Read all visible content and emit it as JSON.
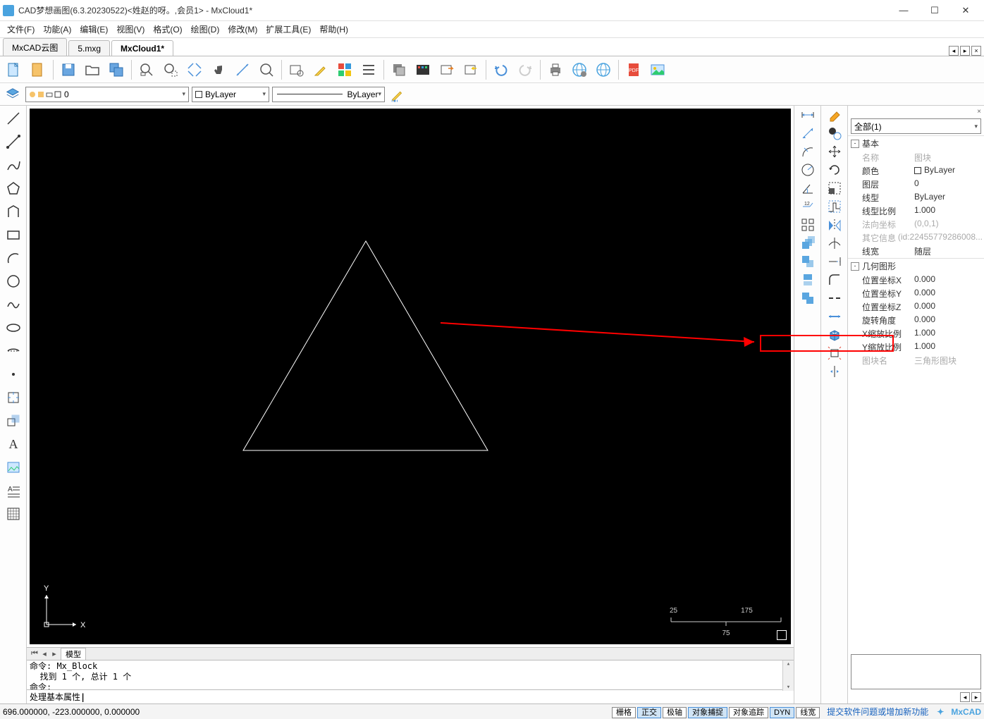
{
  "window": {
    "title": "CAD梦想画图(6.3.20230522)<姓赵的呀。,会员1> - MxCloud1*"
  },
  "menu": [
    "文件(F)",
    "功能(A)",
    "编辑(E)",
    "视图(V)",
    "格式(O)",
    "绘图(D)",
    "修改(M)",
    "扩展工具(E)",
    "帮助(H)"
  ],
  "doctabs": [
    {
      "label": "MxCAD云图",
      "active": false
    },
    {
      "label": "5.mxg",
      "active": false
    },
    {
      "label": "MxCloud1*",
      "active": true
    }
  ],
  "layerbar": {
    "layer_value": "0",
    "color_value": "ByLayer",
    "linetype_value": "ByLayer"
  },
  "properties": {
    "selector": "全部(1)",
    "groups": [
      {
        "title": "基本",
        "rows": [
          {
            "k": "名称",
            "v": "图块",
            "muted": true
          },
          {
            "k": "颜色",
            "v": "ByLayer",
            "swatch": true
          },
          {
            "k": "图层",
            "v": "0"
          },
          {
            "k": "线型",
            "v": "ByLayer"
          },
          {
            "k": "线型比例",
            "v": "1.000"
          },
          {
            "k": "法向坐标",
            "v": "(0,0,1)",
            "muted": true
          },
          {
            "k": "其它信息",
            "v": "(id:22455779286008...",
            "muted": true
          },
          {
            "k": "线宽",
            "v": "随层"
          }
        ]
      },
      {
        "title": "几何图形",
        "rows": [
          {
            "k": "位置坐标X",
            "v": "0.000"
          },
          {
            "k": "位置坐标Y",
            "v": "0.000"
          },
          {
            "k": "位置坐标Z",
            "v": "0.000"
          },
          {
            "k": "旋转角度",
            "v": "0.000"
          },
          {
            "k": "X缩放比例",
            "v": "1.000"
          },
          {
            "k": "Y缩放比例",
            "v": "1.000"
          },
          {
            "k": "图块名",
            "v": "三角形图块",
            "muted": true,
            "highlight": true
          }
        ]
      }
    ]
  },
  "bottom_tab": "模型",
  "command": {
    "history": [
      "命令: Mx_Block",
      "  找到 1 个, 总计 1 个",
      "命令:",
      "命令:"
    ],
    "prompt": "处理基本属性 "
  },
  "statusbar": {
    "coords": "696.000000,  -223.000000,  0.000000",
    "toggles": [
      "栅格",
      "正交",
      "极轴",
      "对象捕捉",
      "对象追踪",
      "DYN",
      "线宽"
    ],
    "active_toggles": [
      "正交",
      "对象捕捉",
      "DYN"
    ],
    "link": "提交软件问题或增加新功能",
    "brand": "MxCAD"
  },
  "scale": {
    "top_left": "25",
    "top_right": "175",
    "bottom": "75"
  },
  "axis": {
    "x": "X",
    "y": "Y"
  }
}
